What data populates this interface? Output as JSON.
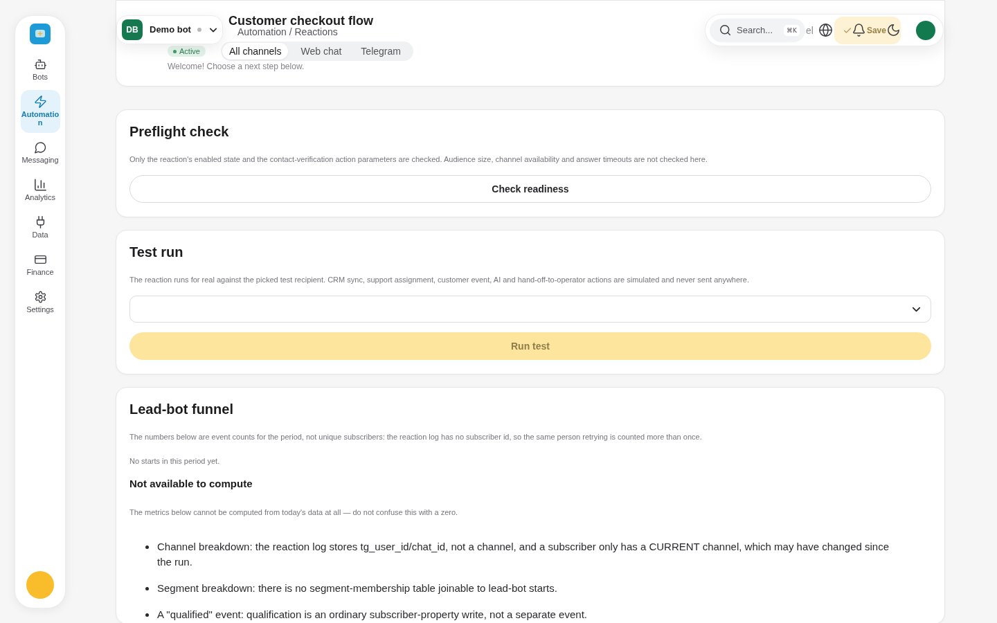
{
  "sidebar": {
    "items": [
      {
        "label": "Bots",
        "selected": false
      },
      {
        "label": "Automation",
        "selected": true
      },
      {
        "label": "Messaging",
        "selected": false
      },
      {
        "label": "Analytics",
        "selected": false
      },
      {
        "label": "Data",
        "selected": false
      },
      {
        "label": "Finance",
        "selected": false
      },
      {
        "label": "Settings",
        "selected": false
      }
    ]
  },
  "bot_switcher": {
    "initials": "DB",
    "name": "Demo bot",
    "online": false
  },
  "top_bar": {
    "search": {
      "placeholder": "Search...",
      "shortcut": "⌘K"
    },
    "actions": [
      {
        "kind": "secondary",
        "label": "el"
      },
      {
        "kind": "primary",
        "label": "Save"
      }
    ]
  },
  "header": {
    "title": "Customer checkout flow",
    "breadcrumb": "Automation / Reactions",
    "status": "Active",
    "tabs": [
      {
        "label": "All channels",
        "selected": true
      },
      {
        "label": "Web chat",
        "selected": false
      },
      {
        "label": "Telegram",
        "selected": false
      }
    ],
    "welcome": "Welcome! Choose a next step below."
  },
  "cards": [
    {
      "title": "Preflight check",
      "blocks": [
        {
          "kind": "note",
          "text": "Only the reaction's enabled state and the contact-verification action parameters are checked. Audience size, channel availability and answer timeouts are not checked here."
        },
        {
          "kind": "button",
          "label": "Check readiness"
        }
      ]
    },
    {
      "title": "Test run",
      "blocks": [
        {
          "kind": "note",
          "text": "The reaction runs for real against the picked test recipient. CRM sync, support assignment, customer event, AI and hand-off-to-operator actions are simulated and never sent anywhere."
        },
        {
          "kind": "select",
          "expanded": false
        },
        {
          "kind": "primary_button",
          "label": "Run test",
          "disabled": true
        }
      ]
    },
    {
      "title": "Lead-bot funnel",
      "blocks": [
        {
          "kind": "note",
          "text": "The numbers below are event counts for the period, not unique subscribers: the reaction log has no subscriber id, so the same person retrying is counted more than once."
        },
        {
          "kind": "note",
          "text": "No starts in this period yet."
        },
        {
          "kind": "subheading",
          "text": "Not available to compute"
        },
        {
          "kind": "note",
          "text": "The metrics below cannot be computed from today's data at all — do not confuse this with a zero."
        },
        {
          "kind": "bullets",
          "items": [
            "Channel breakdown: the reaction log stores tg_user_id/chat_id, not a channel, and a subscriber only has a CURRENT channel, which may have changed since the run.",
            "Segment breakdown: there is no segment-membership table joinable to lead-bot starts.",
            "A \"qualified\" event: qualification is an ordinary subscriber-property write, not a separate event."
          ]
        }
      ]
    }
  ]
}
